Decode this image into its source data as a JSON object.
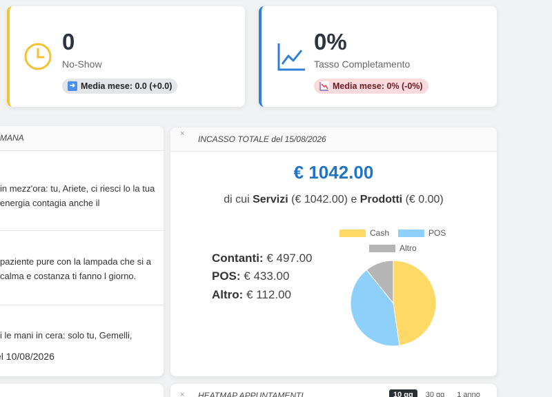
{
  "kpis": [
    {
      "value": "0",
      "label": "No-Show",
      "badge": "Media mese: 0.0 (+0.0)",
      "badge_icon": "right-arrow-icon",
      "accent": "#f2c230"
    },
    {
      "value": "0%",
      "label": "Tasso Completamento",
      "badge": "Media mese: 0% (-0%)",
      "badge_icon": "chart-down-icon",
      "accent": "#2f7fd8"
    }
  ],
  "horoscope": {
    "title": "MANA",
    "items": [
      "in mezz'ora: tu, Ariete, ci riesci lo la tua energia contagia anche il",
      "paziente pure con la lampada che si a calma e costanza ti fanno l giorno.",
      "i le mani in cera: solo tu, Gemelli,"
    ],
    "date": "el 10/08/2026"
  },
  "income": {
    "close": "×",
    "title": "INCASSO TOTALE del  15/08/2026",
    "total": "€ 1042.00",
    "sub_prefix": "di cui",
    "sub_services_label": "Servizi",
    "sub_services_value": "(€ 1042.00)",
    "sub_and": "e",
    "sub_products_label": "Prodotti",
    "sub_products_value": "(€ 0.00)",
    "breakdown": [
      {
        "label": "Contanti:",
        "value": "€ 497.00"
      },
      {
        "label": "POS:",
        "value": "€ 433.00"
      },
      {
        "label": "Altro:",
        "value": "€ 112.00"
      }
    ]
  },
  "chart_data": {
    "type": "pie",
    "labels": [
      "Cash",
      "POS",
      "Altro"
    ],
    "values": [
      497,
      433,
      112
    ],
    "colors": [
      "#ffd966",
      "#8fd0fb",
      "#b5b5b5"
    ],
    "legend": "top"
  },
  "heatmap": {
    "close": "×",
    "title": "HEATMAP APPUNTAMENTI",
    "tabs": [
      "10 gg",
      "30 gg",
      "1 anno"
    ]
  }
}
